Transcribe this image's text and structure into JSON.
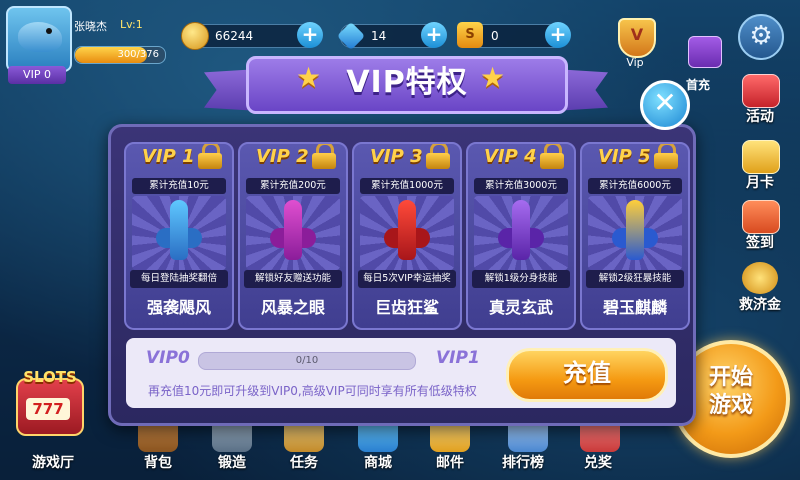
{
  "player": {
    "name": "张晓杰",
    "level": "Lv:1",
    "vip_badge": "VIP 0",
    "exp_text": "300/376",
    "exp_fraction": 0.8
  },
  "resources": {
    "coins": "66244",
    "gems": "14",
    "tickets": "0",
    "ticket_icon_letter": "S"
  },
  "top_right": {
    "vip_label": "Vip",
    "first_charge_label": "首充"
  },
  "side_menu": [
    {
      "label": "活动",
      "icon": "gift-icon"
    },
    {
      "label": "月卡",
      "icon": "calendar-icon"
    },
    {
      "label": "签到",
      "icon": "checkin-icon"
    },
    {
      "label": "救济金",
      "icon": "coins-icon"
    }
  ],
  "start_button": {
    "label": "开始\n游戏"
  },
  "slots": {
    "word": "SLOTS",
    "reels": "777",
    "label": "游戏厅"
  },
  "bottom_nav": [
    {
      "label": "背包"
    },
    {
      "label": "锻造"
    },
    {
      "label": "任务"
    },
    {
      "label": "商城"
    },
    {
      "label": "邮件"
    },
    {
      "label": "排行榜"
    },
    {
      "label": "兑奖"
    }
  ],
  "modal": {
    "title": "VIP特权",
    "close_symbol": "✕",
    "star_symbol": "★",
    "cards": [
      {
        "vip": "VIP 1",
        "charge": "累计充值10元",
        "desc": "每日登陆抽奖翻倍",
        "skill": "强袭飓风",
        "ship_color": "#5fc8ff",
        "ship_accent": "#2a6ec4"
      },
      {
        "vip": "VIP 2",
        "charge": "累计充值200元",
        "desc": "解锁好友赠送功能",
        "skill": "风暴之眼",
        "ship_color": "#e04fd0",
        "ship_accent": "#8b1d9a"
      },
      {
        "vip": "VIP 3",
        "charge": "累计充值1000元",
        "desc": "每日5次VIP幸运抽奖",
        "skill": "巨齿狂鲨",
        "ship_color": "#ff4a3a",
        "ship_accent": "#a8161a"
      },
      {
        "vip": "VIP 4",
        "charge": "累计充值3000元",
        "desc": "解锁1级分身技能",
        "skill": "真灵玄武",
        "ship_color": "#a66cf0",
        "ship_accent": "#5a24a8"
      },
      {
        "vip": "VIP 5",
        "charge": "累计充值6000元",
        "desc": "解锁2级狂暴技能",
        "skill": "碧玉麒麟",
        "ship_color": "#ffcf3a",
        "ship_accent": "#2a5ad0"
      }
    ],
    "progress": {
      "from": "VIP0",
      "to": "VIP1",
      "text": "0/10",
      "fraction": 0.0
    },
    "hint": "再充值10元即可升级到VIP0,高级VIP可同时享有所有低级特权",
    "recharge_label": "充值"
  },
  "colors": {
    "accent": "#f59a12",
    "modal_bg": "#3b3477",
    "vip_text": "#ffd24a"
  }
}
